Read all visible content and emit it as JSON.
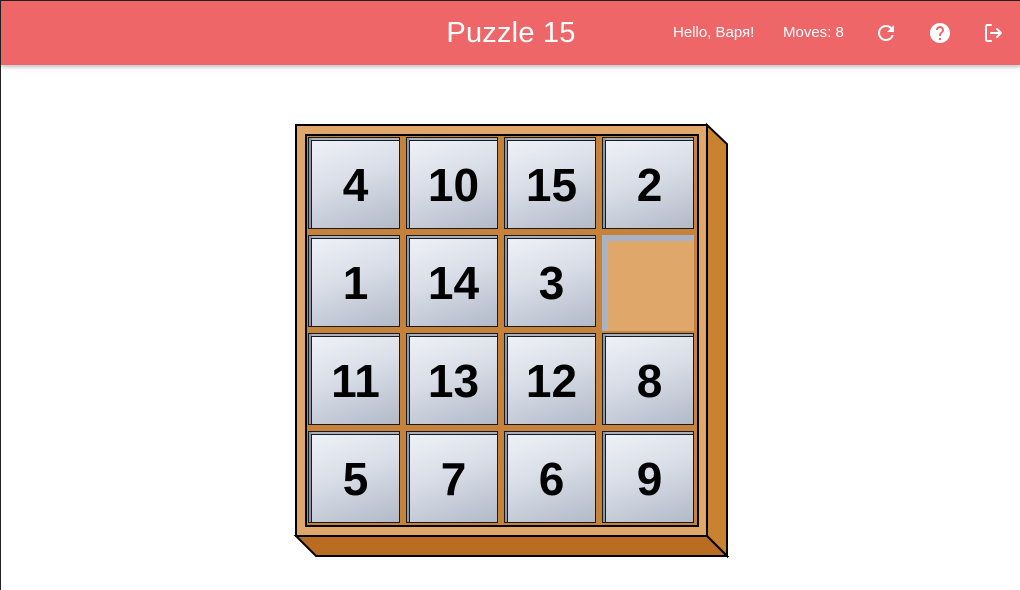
{
  "app": {
    "title": "Puzzle 15",
    "greeting": "Hello, Варя!",
    "moves_label": "Moves: 8"
  },
  "toolbar": {
    "refresh_icon": "refresh-icon",
    "help_icon": "help-icon",
    "logout_icon": "logout-icon"
  },
  "colors": {
    "header": "#ef6669",
    "frame_light": "#dfa76a",
    "frame_dark": "#b86d23",
    "tile_light": "#eef1f7",
    "tile_dark": "#b2bac8"
  },
  "board": {
    "size": 4,
    "tiles": [
      [
        "4",
        "10",
        "15",
        "2"
      ],
      [
        "1",
        "14",
        "3",
        ""
      ],
      [
        "11",
        "13",
        "12",
        "8"
      ],
      [
        "5",
        "7",
        "6",
        "9"
      ]
    ],
    "empty": {
      "row": 1,
      "col": 3
    }
  }
}
